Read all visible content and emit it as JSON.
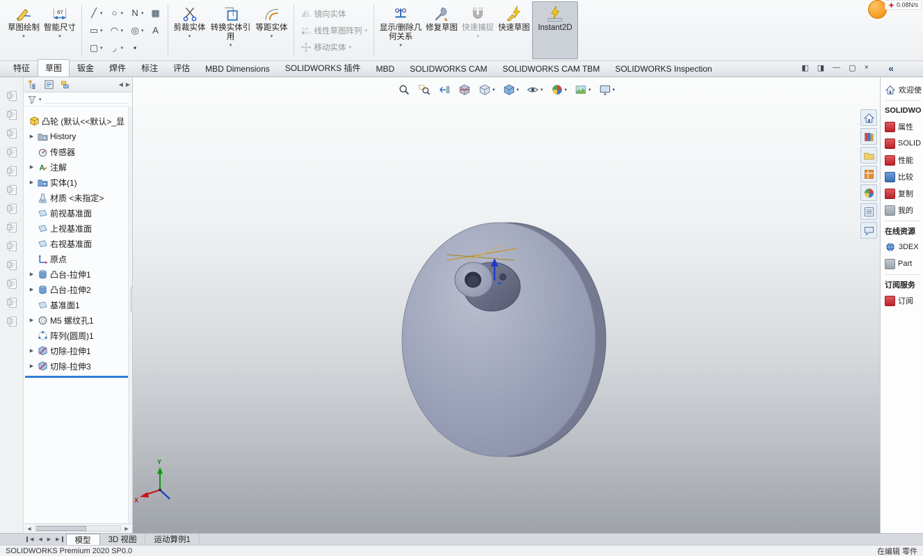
{
  "titlebar": {
    "network_status": "0.08N/s"
  },
  "ribbon": {
    "groups": [
      {
        "type": "large",
        "buttons": [
          {
            "name": "sketch",
            "icon": "sketch",
            "label": "草图绘制",
            "dropdown": true
          },
          {
            "name": "smart-dimension",
            "icon": "dimension",
            "label": "智能尺寸",
            "dropdown": true
          }
        ]
      },
      {
        "type": "grid",
        "rows": [
          [
            {
              "name": "line-tool",
              "glyph": "╱",
              "dropdown": true
            },
            {
              "name": "circle-tool",
              "glyph": "○",
              "dropdown": true
            },
            {
              "name": "spline-tool",
              "glyph": "N",
              "dropdown": true
            },
            {
              "name": "sketch-picture-tool",
              "glyph": "▦",
              "dropdown": false
            }
          ],
          [
            {
              "name": "rectangle-tool",
              "glyph": "▭",
              "dropdown": true
            },
            {
              "name": "arc-tool",
              "glyph": "◠",
              "dropdown": true
            },
            {
              "name": "ellipse-tool",
              "glyph": "◎",
              "dropdown": true
            },
            {
              "name": "text-tool",
              "glyph": "A",
              "dropdown": false
            }
          ],
          [
            {
              "name": "slot-tool",
              "glyph": "▢",
              "dropdown": true
            },
            {
              "name": "fillet-tool",
              "glyph": "◞",
              "dropdown": true
            },
            {
              "name": "point-tool",
              "glyph": "•",
              "dropdown": false
            }
          ]
        ]
      },
      {
        "type": "large",
        "buttons": [
          {
            "name": "trim-entities",
            "icon": "trim",
            "label": "剪裁实体",
            "dropdown": true
          },
          {
            "name": "convert-entities",
            "icon": "convert",
            "label": "转换实体引用",
            "dropdown": true
          },
          {
            "name": "offset-entities",
            "icon": "offset",
            "label": "等距实体",
            "dropdown": true
          }
        ]
      },
      {
        "type": "stack",
        "buttons": [
          {
            "name": "mirror-entities",
            "icon": "mirror",
            "label": "镜向实体",
            "disabled": true
          },
          {
            "name": "linear-sketch-pattern",
            "icon": "pattern-lin",
            "label": "线性草图阵列",
            "disabled": true,
            "dropdown": true
          },
          {
            "name": "move-entities",
            "icon": "move",
            "label": "移动实体",
            "disabled": true,
            "dropdown": true
          }
        ]
      },
      {
        "type": "large",
        "buttons": [
          {
            "name": "display-delete-relations",
            "icon": "relations",
            "label": "显示/删除几何关系",
            "dropdown": true
          },
          {
            "name": "repair-sketch",
            "icon": "repair",
            "label": "修复草图"
          },
          {
            "name": "quick-snaps",
            "icon": "snap",
            "label": "快速捕捉",
            "dropdown": true,
            "disabled": true
          },
          {
            "name": "rapid-sketch",
            "icon": "rapid",
            "label": "快速草图"
          },
          {
            "name": "instant2d",
            "icon": "instant2d",
            "label": "Instant2D",
            "active": true
          }
        ]
      }
    ]
  },
  "command_tabs": {
    "items": [
      "特征",
      "草图",
      "钣金",
      "焊件",
      "标注",
      "评估",
      "MBD Dimensions",
      "SOLIDWORKS 插件",
      "MBD",
      "SOLIDWORKS CAM",
      "SOLIDWORKS CAM TBM",
      "SOLIDWORKS Inspection"
    ],
    "active_index": 1
  },
  "window_controls": [
    {
      "name": "dock-pane-left"
    },
    {
      "name": "dock-pane-right"
    },
    {
      "name": "minimize"
    },
    {
      "name": "restore"
    },
    {
      "name": "close"
    }
  ],
  "feature_manager": {
    "tabs": [
      {
        "name": "feature-tree-tab",
        "icon": "fm-tree"
      },
      {
        "name": "property-manager-tab",
        "icon": "fm-pm"
      },
      {
        "name": "configuration-manager-tab",
        "icon": "fm-cfg"
      }
    ],
    "root": {
      "label": "凸轮 (默认<<默认>_显",
      "icon": "part"
    },
    "items": [
      {
        "label": "History",
        "icon": "history",
        "arrow": true
      },
      {
        "label": "传感器",
        "icon": "sensor"
      },
      {
        "label": "注解",
        "icon": "annotation",
        "arrow": true
      },
      {
        "label": "实体(1)",
        "icon": "bodies",
        "arrow": true
      },
      {
        "label": "材质 <未指定>",
        "icon": "material"
      },
      {
        "label": "前视基准面",
        "icon": "plane"
      },
      {
        "label": "上视基准面",
        "icon": "plane"
      },
      {
        "label": "右视基准面",
        "icon": "plane"
      },
      {
        "label": "原点",
        "icon": "origin"
      },
      {
        "label": "凸台-拉伸1",
        "icon": "extrude",
        "arrow": true
      },
      {
        "label": "凸台-拉伸2",
        "icon": "extrude",
        "arrow": true
      },
      {
        "label": "基准面1",
        "icon": "plane"
      },
      {
        "label": "M5 螺纹孔1",
        "icon": "thread",
        "arrow": true
      },
      {
        "label": "阵列(圆周)1",
        "icon": "circular-pattern"
      },
      {
        "label": "切除-拉伸1",
        "icon": "cut",
        "arrow": true
      },
      {
        "label": "切除-拉伸3",
        "icon": "cut",
        "arrow": true
      }
    ]
  },
  "left_toolbar": {
    "button_count": 13
  },
  "viewport": {
    "headsup": [
      {
        "name": "zoom-fit",
        "icon": "magnifier"
      },
      {
        "name": "zoom-area",
        "icon": "magnifier-area"
      },
      {
        "name": "previous-view",
        "icon": "prev-view"
      },
      {
        "name": "section-view",
        "icon": "section"
      },
      {
        "name": "view-orientation",
        "icon": "cube",
        "dropdown": true
      },
      {
        "name": "display-style",
        "icon": "display-style",
        "dropdown": true
      },
      {
        "name": "hide-show-items",
        "icon": "eye",
        "dropdown": true
      },
      {
        "name": "edit-appearance",
        "icon": "ball",
        "dropdown": true
      },
      {
        "name": "apply-scene",
        "icon": "scene",
        "dropdown": true
      },
      {
        "name": "view-settings",
        "icon": "monitor",
        "dropdown": true
      }
    ],
    "right_tabs": [
      {
        "name": "home-tab",
        "icon": "house"
      },
      {
        "name": "design-library-tab",
        "icon": "library"
      },
      {
        "name": "file-explorer-tab",
        "icon": "folderx"
      },
      {
        "name": "view-palette-tab",
        "icon": "palette"
      },
      {
        "name": "appearances-tab",
        "icon": "ball"
      },
      {
        "name": "custom-properties-tab",
        "icon": "listgrid"
      },
      {
        "name": "forum-tab",
        "icon": "comment"
      }
    ],
    "triad": {
      "x": "X",
      "y": "Y"
    }
  },
  "task_pane": {
    "collapse": "«",
    "items": [
      {
        "label": "欢迎使",
        "icon": "house",
        "type": "item"
      },
      {
        "label": "SOLIDWO",
        "type": "header"
      },
      {
        "label": "属性",
        "icon": "chip-red",
        "type": "item"
      },
      {
        "label": "SOLID",
        "icon": "chip-red",
        "type": "item"
      },
      {
        "label": "性能",
        "icon": "chip-red",
        "type": "item"
      },
      {
        "label": "比较",
        "icon": "chip-blue",
        "type": "item"
      },
      {
        "label": "复制",
        "icon": "chip-red",
        "type": "item"
      },
      {
        "label": "我的",
        "icon": "chip-gray",
        "type": "item"
      },
      {
        "label": "在线资源",
        "type": "header"
      },
      {
        "label": "3DEX",
        "icon": "globe",
        "type": "item"
      },
      {
        "label": "Part",
        "icon": "chip-gray",
        "type": "item"
      },
      {
        "label": "订阅服务",
        "type": "header"
      },
      {
        "label": "订阅",
        "icon": "chip-red",
        "type": "item"
      }
    ]
  },
  "bottom_tabs": {
    "nav": [
      "first",
      "prev",
      "next",
      "last"
    ],
    "items": [
      "模型",
      "3D 视图",
      "运动算例1"
    ],
    "active_index": 0
  },
  "status_bar": {
    "left": "SOLIDWORKS Premium 2020 SP0.0",
    "right": "在编辑 零件"
  }
}
